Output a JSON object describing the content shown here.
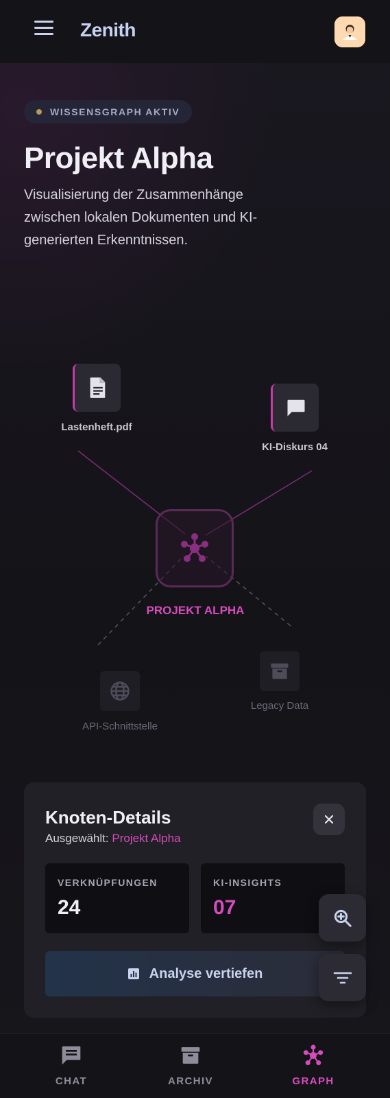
{
  "header": {
    "brand": "Zenith"
  },
  "hero": {
    "badge": "WISSENSGRAPH AKTIV",
    "title": "Projekt Alpha",
    "subtitle": "Visualisierung der Zusammenhänge zwischen lokalen Dokumenten und KI-generierten Erkenntnissen."
  },
  "graph": {
    "nodes": [
      {
        "label": "Lastenheft.pdf",
        "icon": "document-icon"
      },
      {
        "label": "KI-Diskurs 04",
        "icon": "chat-bubble-icon"
      },
      {
        "label": "PROJEKT ALPHA",
        "icon": "hub-icon"
      },
      {
        "label": "API-Schnittstelle",
        "icon": "globe-icon"
      },
      {
        "label": "Legacy Data",
        "icon": "archive-box-icon"
      }
    ]
  },
  "details": {
    "title": "Knoten-Details",
    "selected_prefix": "Ausgewählt:",
    "selected_value": "Projekt Alpha",
    "stats": [
      {
        "label": "VERKNÜPFUNGEN",
        "value": "24"
      },
      {
        "label": "KI-INSIGHTS",
        "value": "07"
      }
    ],
    "action_label": "Analyse vertiefen"
  },
  "nav": {
    "items": [
      {
        "label": "CHAT",
        "icon": "chat-icon"
      },
      {
        "label": "ARCHIV",
        "icon": "archive-icon"
      },
      {
        "label": "GRAPH",
        "icon": "graph-icon"
      }
    ]
  },
  "colors": {
    "accent": "#d64cbd",
    "background": "#15141a",
    "card": "#212026"
  }
}
